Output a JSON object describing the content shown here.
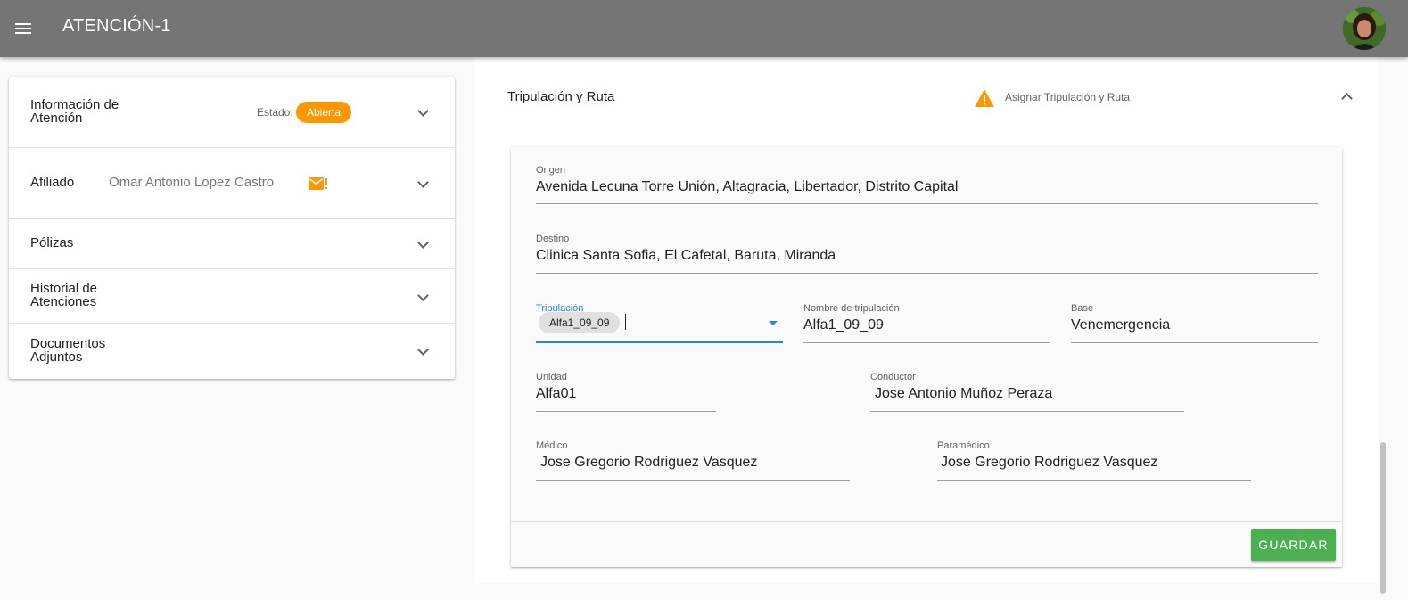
{
  "app": {
    "title": "ATENCIÓN-1"
  },
  "left": {
    "items": [
      {
        "title": "Información de Atención",
        "estado_label": "Estado:",
        "estado_value": "Abierta"
      },
      {
        "title": "Afiliado",
        "name": "Omar Antonio Lopez Castro"
      },
      {
        "title": "Pólizas"
      },
      {
        "title": "Historial de Atenciones"
      },
      {
        "title": "Documentos Adjuntos"
      }
    ]
  },
  "right": {
    "title": "Tripulación y Ruta",
    "warning": "Asignar Tripulación y Ruta",
    "form": {
      "origen": {
        "label": "Origen",
        "value": "Avenida Lecuna Torre Unión, Altagracia, Libertador, Distrito Capital"
      },
      "destino": {
        "label": "Destino",
        "value": "Clinica Santa Sofia, El Cafetal, Baruta, Miranda"
      },
      "tripulacion": {
        "label": "Tripulación",
        "chip": "Alfa1_09_09"
      },
      "nombre_tripulacion": {
        "label": "Nombre de tripulación",
        "value": "Alfa1_09_09"
      },
      "base": {
        "label": "Base",
        "value": "Venemergencia"
      },
      "unidad": {
        "label": "Unidad",
        "value": "Alfa01"
      },
      "conductor": {
        "label": "Conductor",
        "value": "Jose Antonio Muñoz Peraza"
      },
      "medico": {
        "label": "Médico",
        "value": "Jose Gregorio Rodriguez Vasquez"
      },
      "paramedico": {
        "label": "Paramédico",
        "value": "Jose Gregorio Rodriguez Vasquez"
      }
    },
    "save_label": "GUARDAR"
  },
  "colors": {
    "appbar": "#757575",
    "estado_badge": "#ff9800",
    "warning": "#ff9800",
    "save_button": "#4caf50",
    "focus": "#1e88e5"
  },
  "icons": [
    "menu-icon",
    "avatar",
    "mail-alert-icon",
    "warning-icon",
    "chevron-down-icon",
    "chevron-up-icon",
    "dropdown-arrow-icon"
  ]
}
